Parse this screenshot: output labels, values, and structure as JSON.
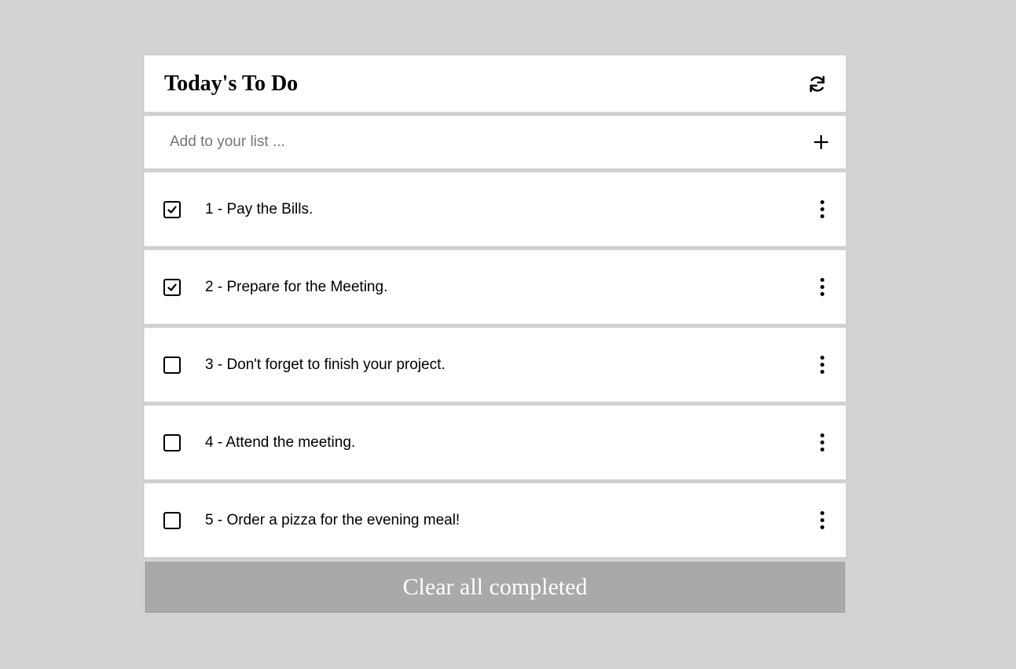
{
  "header": {
    "title": "Today's To Do",
    "refresh_icon": "refresh-icon"
  },
  "add": {
    "placeholder": "Add to your list ...",
    "value": "",
    "add_icon": "plus-icon"
  },
  "items": [
    {
      "label": "1 - Pay the Bills.",
      "checked": true
    },
    {
      "label": "2 - Prepare for the Meeting.",
      "checked": true
    },
    {
      "label": "3 - Don't forget to finish your project.",
      "checked": false
    },
    {
      "label": "4 - Attend the meeting.",
      "checked": false
    },
    {
      "label": "5 - Order a pizza for the evening meal!",
      "checked": false
    }
  ],
  "footer": {
    "clear_label": "Clear all completed"
  },
  "colors": {
    "background": "#d3d3d3",
    "panel": "#ffffff",
    "clear_button": "#a9a9a9"
  }
}
